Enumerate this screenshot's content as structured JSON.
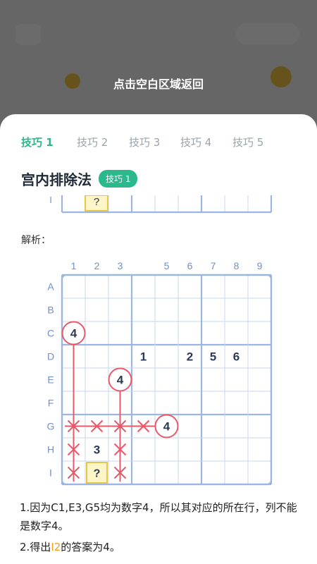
{
  "background": {
    "hint": "点击空白区域返回"
  },
  "tabs": [
    {
      "label": "技巧 1",
      "active": true
    },
    {
      "label": "技巧 2",
      "active": false
    },
    {
      "label": "技巧 3",
      "active": false
    },
    {
      "label": "技巧 4",
      "active": false
    },
    {
      "label": "技巧 5",
      "active": false
    }
  ],
  "section": {
    "title": "宫内排除法",
    "badge": "技巧 1"
  },
  "mini_row": {
    "label": "I",
    "mark": "?"
  },
  "analysis_label": "解析：",
  "board": {
    "col_labels": [
      "1",
      "2",
      "3",
      "",
      "5",
      "6",
      "7",
      "8",
      "9"
    ],
    "row_labels": [
      "A",
      "B",
      "C",
      "D",
      "E",
      "F",
      "G",
      "H",
      "I"
    ],
    "givens": [
      {
        "row": 2,
        "col": 0,
        "value": "4",
        "circled": true
      },
      {
        "row": 3,
        "col": 3,
        "value": "1",
        "circled": false
      },
      {
        "row": 3,
        "col": 5,
        "value": "2",
        "circled": false
      },
      {
        "row": 3,
        "col": 6,
        "value": "5",
        "circled": false
      },
      {
        "row": 3,
        "col": 7,
        "value": "6",
        "circled": false
      },
      {
        "row": 4,
        "col": 2,
        "value": "4",
        "circled": true
      },
      {
        "row": 6,
        "col": 4,
        "value": "4",
        "circled": true
      },
      {
        "row": 7,
        "col": 1,
        "value": "3",
        "circled": false
      }
    ],
    "target": {
      "row": 8,
      "col": 1,
      "mark": "?"
    },
    "crosses": [
      {
        "row": 6,
        "col": 0
      },
      {
        "row": 6,
        "col": 1
      },
      {
        "row": 6,
        "col": 2
      },
      {
        "row": 6,
        "col": 3
      },
      {
        "row": 7,
        "col": 0
      },
      {
        "row": 7,
        "col": 2
      },
      {
        "row": 8,
        "col": 0
      },
      {
        "row": 8,
        "col": 2
      }
    ],
    "colors": {
      "grid_thin": "#c9d7ee",
      "grid_thick": "#9bb6e3",
      "label": "#6f8fd0",
      "number": "#2b3a55",
      "accent": "#e85a6a",
      "target_fill": "#fff6c8",
      "target_border": "#e8c64a"
    }
  },
  "notes": {
    "line1": "1.因为C1,E3,G5均为数字4，所以其对应的所在行，列不能是数字4。",
    "line2_prefix": "2.得出",
    "line2_highlight": "I2",
    "line2_suffix": "的答案为4。"
  }
}
